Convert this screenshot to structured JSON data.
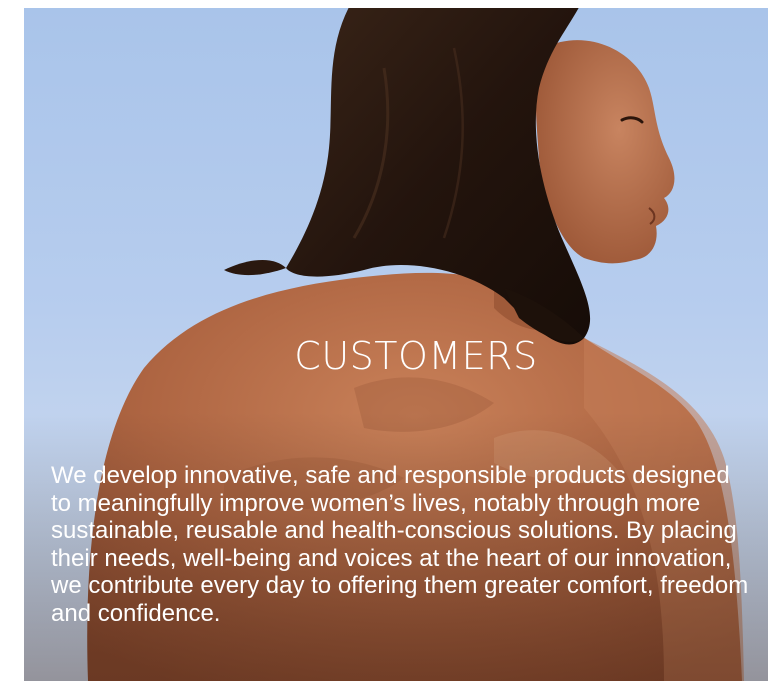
{
  "section": {
    "title": "CUSTOMERS",
    "body": "We develop innovative, safe and responsible products designed to meaningfully improve women’s lives, notably through more sustainable, reusable and health-conscious solutions. By placing their needs, well-being and voices at the heart of our innovation, we contribute every day to offering them greater comfort, freedom and confidence."
  },
  "colors": {
    "sky": "#b7cdee",
    "skin": "#b86f4a",
    "hair": "#24150f",
    "text": "#ffffff"
  },
  "image": {
    "subject": "woman-back-photo"
  }
}
